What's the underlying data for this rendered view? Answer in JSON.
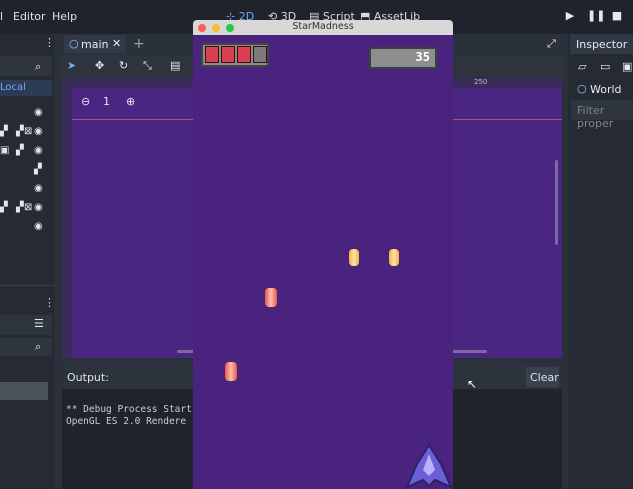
{
  "menu": {
    "items": [
      {
        "label": "l"
      },
      {
        "label": "Editor"
      },
      {
        "label": "Help"
      }
    ]
  },
  "modes": {
    "two_d": "2D",
    "three_d": "3D",
    "script": "Script",
    "assetlib": "AssetLib"
  },
  "viewport": {
    "tab_label": "main",
    "zoom_reset": "1",
    "ruler_mark": "250"
  },
  "scene_dock": {
    "local_label": "Local"
  },
  "inspector": {
    "title": "Inspector",
    "world_label": "World",
    "filter_placeholder": "Filter proper"
  },
  "output": {
    "title": "Output:",
    "clear_label": "Clear",
    "lines": [
      "** Debug Process Start",
      "OpenGL ES 2.0 Rendere"
    ]
  },
  "game": {
    "title": "StarMadness",
    "score": "35",
    "health": {
      "filled": 3,
      "total": 4
    }
  },
  "colors": {
    "accent": "#6ea8ff",
    "game_bg": "#4a237e",
    "health": "#d94050"
  }
}
